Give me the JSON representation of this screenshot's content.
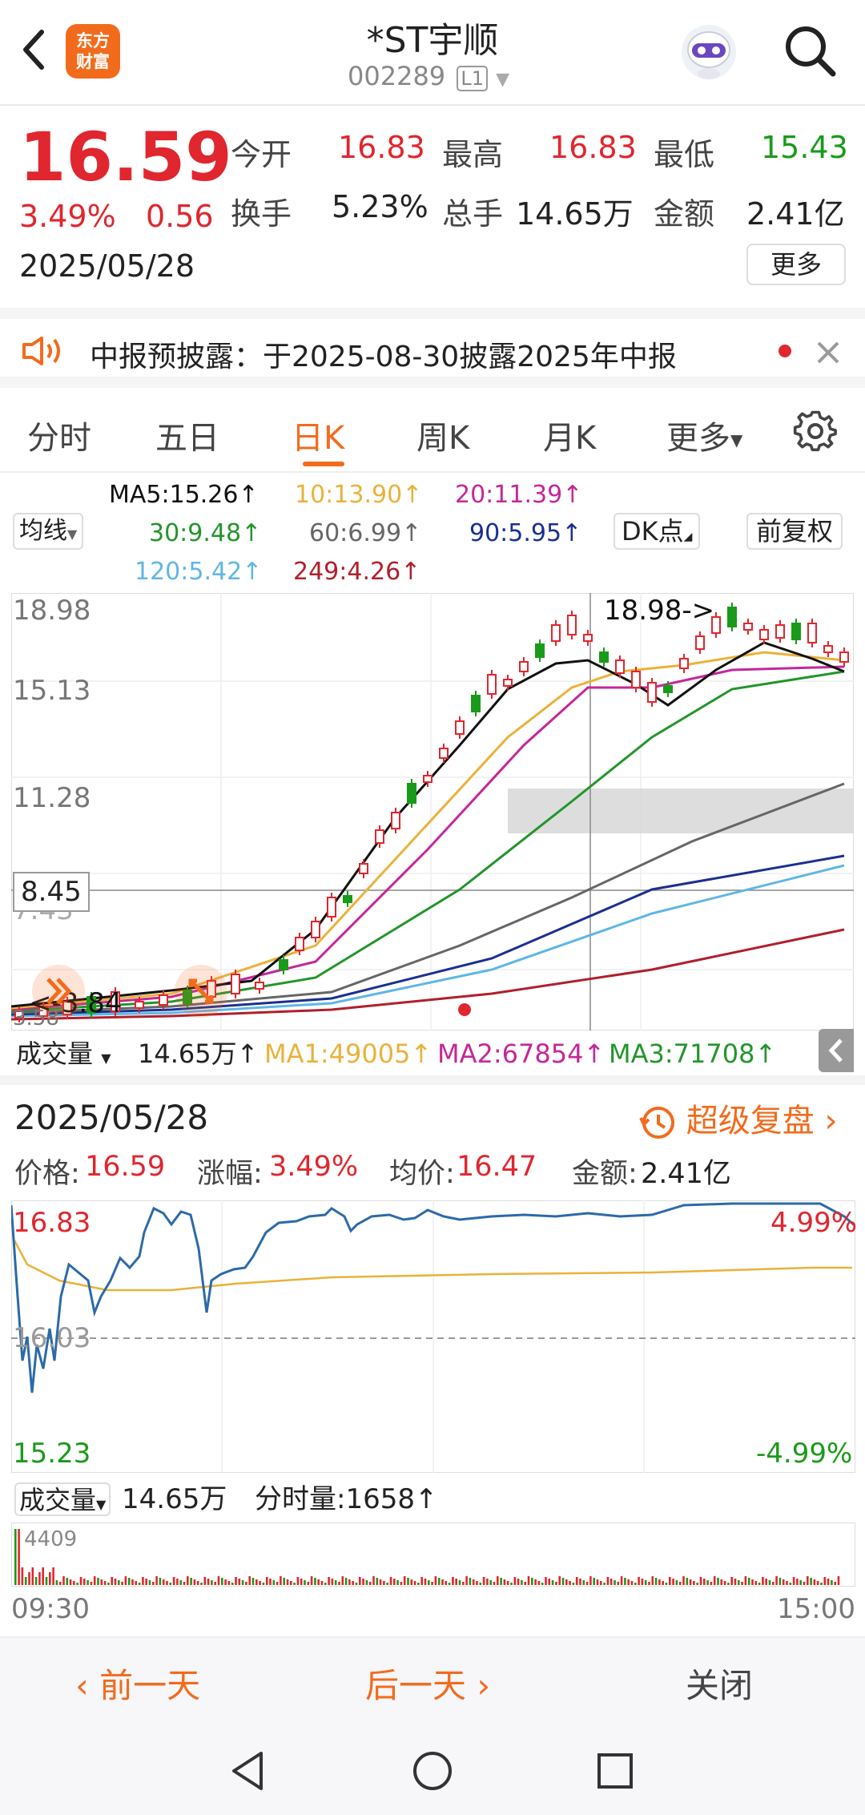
{
  "header": {
    "logo_line1": "东方",
    "logo_line2": "财富",
    "title": "*ST宇顺",
    "code": "002289",
    "level": "L1"
  },
  "quote": {
    "price": "16.59",
    "change_pct": "3.49%",
    "change": "0.56",
    "date": "2025/05/28",
    "open_label": "今开",
    "open": "16.83",
    "high_label": "最高",
    "high": "16.83",
    "low_label": "最低",
    "low": "15.43",
    "turnover_label": "换手",
    "turnover": "5.23%",
    "volume_label": "总手",
    "volume": "14.65万",
    "amount_label": "金额",
    "amount": "2.41亿",
    "more": "更多"
  },
  "notice": {
    "text": "中报预披露：于2025-08-30披露2025年中报"
  },
  "tabs": [
    "分时",
    "五日",
    "日K",
    "周K",
    "月K",
    "更多"
  ],
  "ma_panel": {
    "select": "均线",
    "ma5": "MA5:15.26↑",
    "ma10": "10:13.90↑",
    "ma20": "20:11.39↑",
    "ma30": "30:9.48↑",
    "ma60": "60:6.99↑",
    "ma90": "90:5.95↑",
    "ma120": "120:5.42↑",
    "ma249": "249:4.26↑",
    "dk": "DK点",
    "adjust": "前复权"
  },
  "kchart": {
    "y_labels": [
      "18.98",
      "15.13",
      "11.28",
      "7.43"
    ],
    "cross_price": "8.45",
    "max_annot": "18.98->",
    "min_annot": "<-3.84",
    "bottom_partial": "3.58"
  },
  "volume_row": {
    "select": "成交量",
    "value": "14.65万↑",
    "ma1": "MA1:49005↑",
    "ma2": "MA2:67854↑",
    "ma3": "MA3:71708↑"
  },
  "detail": {
    "date": "2025/05/28",
    "replay": "超级复盘",
    "price_label": "价格:",
    "price": "16.59",
    "chg_label": "涨幅:",
    "chg": "3.49%",
    "avg_label": "均价:",
    "avg": "16.47",
    "amt_label": "金额:",
    "amt": "2.41亿",
    "top_price": "16.83",
    "mid_price": "16.03",
    "bottom_price": "15.23",
    "top_pct": "4.99%",
    "bottom_pct": "-4.99%",
    "vol_select": "成交量",
    "vol_value": "14.65万",
    "tick_vol": "分时量:1658↑",
    "vol_max": "4409",
    "time_start": "09:30",
    "time_end": "15:00"
  },
  "footer": {
    "prev": "前一天",
    "next": "后一天",
    "close": "关闭"
  },
  "colors": {
    "red": "#e0262e",
    "green": "#1a9a1a",
    "orange": "#f26b1d",
    "ma5": "#111111",
    "ma10": "#e9b23a",
    "ma20": "#c4279a",
    "ma30": "#23952b",
    "ma60": "#666666",
    "ma90": "#1b2f8f",
    "ma120": "#5fb6e6",
    "ma249": "#b01f2c"
  }
}
